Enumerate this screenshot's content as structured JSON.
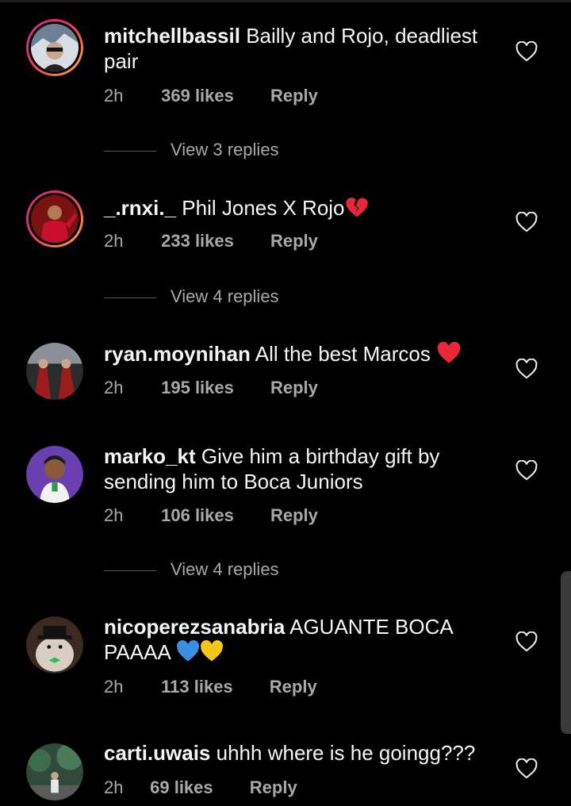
{
  "comments": [
    {
      "username": "mitchellbassil",
      "text": "Bailly and Rojo, deadliest pair",
      "time": "2h",
      "likes": "369 likes",
      "reply_label": "Reply",
      "view_replies": "View 3 replies",
      "story_ring": true
    },
    {
      "username": "_.rnxi._",
      "text": "Phil Jones X Rojo",
      "emoji": "broken-heart",
      "time": "2h",
      "likes": "233 likes",
      "reply_label": "Reply",
      "view_replies": "View 4 replies",
      "story_ring": true
    },
    {
      "username": "ryan.moynihan",
      "text": "All the best Marcos",
      "emoji": "red-heart",
      "time": "2h",
      "likes": "195 likes",
      "reply_label": "Reply",
      "story_ring": false
    },
    {
      "username": "marko_kt",
      "text": "Give him a birthday gift by sending him to Boca Juniors",
      "time": "2h",
      "likes": "106 likes",
      "reply_label": "Reply",
      "view_replies": "View 4 replies",
      "story_ring": false
    },
    {
      "username": "nicoperezsanabria",
      "text": "AGUANTE BOCA PAAAA",
      "emoji": "blue-heart yellow-heart",
      "time": "2h",
      "likes": "113 likes",
      "reply_label": "Reply",
      "story_ring": false
    },
    {
      "username": "carti.uwais",
      "text": "uhhh where is he goingg???",
      "time": "2h",
      "likes": "69 likes",
      "reply_label": "Reply",
      "story_ring": false
    }
  ],
  "colors": {
    "background": "#000000",
    "text": "#f5f5f5",
    "meta": "#a8a8a8"
  }
}
